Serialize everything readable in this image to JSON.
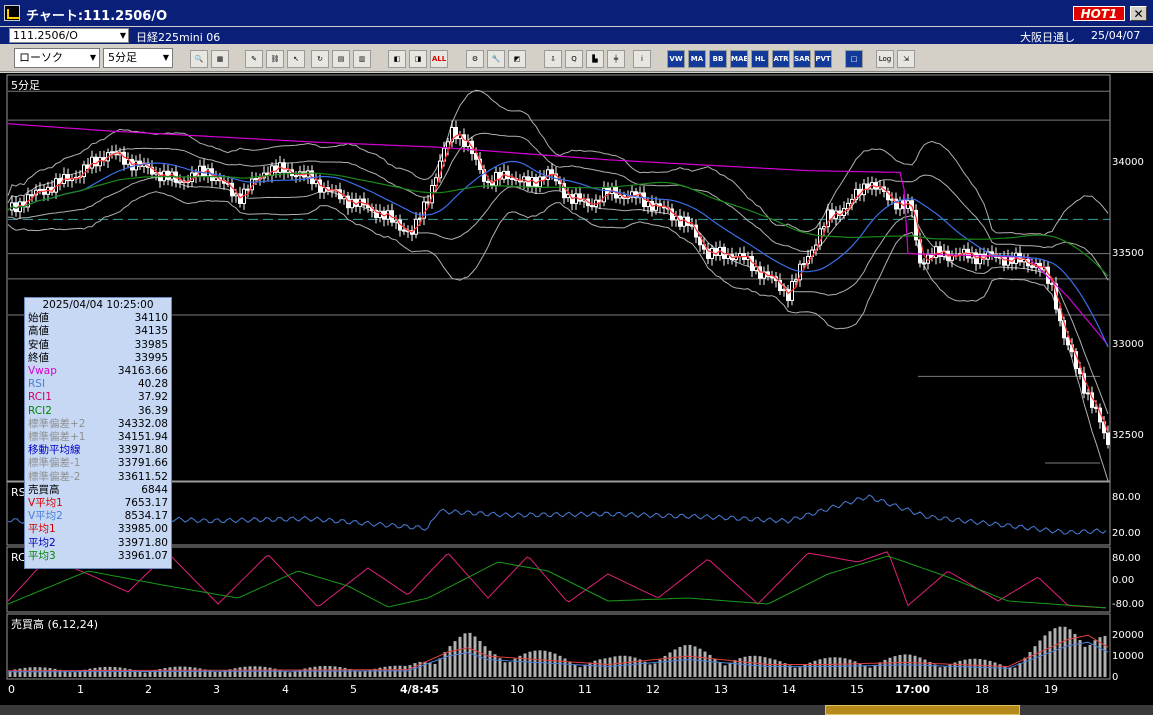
{
  "window": {
    "title": "チャート:111.2506/O",
    "hot_badge": "HOT1",
    "close_glyph": "✕"
  },
  "infobar": {
    "symbol_code": "111.2506/O",
    "symbol_name": "日経225mini 06",
    "market": "大阪日通し",
    "date": "25/04/07"
  },
  "toolbar": {
    "chart_type": "ローソク",
    "interval": "5分足",
    "buttons": [
      {
        "name": "zoom-icon",
        "label": "🔍"
      },
      {
        "name": "grid-icon",
        "label": "▦"
      },
      {
        "name": "pen-icon",
        "label": "✎"
      },
      {
        "name": "link-icon",
        "label": "⛓"
      },
      {
        "name": "cursor-icon",
        "label": "↖"
      },
      {
        "name": "refresh-icon",
        "label": "↻"
      },
      {
        "name": "doc-icon",
        "label": "▤"
      },
      {
        "name": "trash-icon",
        "label": "▥"
      },
      {
        "name": "candle-left-icon",
        "label": "◧"
      },
      {
        "name": "candle-right-icon",
        "label": "◨"
      },
      {
        "name": "all-icon",
        "label": "ALL"
      },
      {
        "name": "settings-icon",
        "label": "⚙"
      },
      {
        "name": "wrench-icon",
        "label": "🔧"
      },
      {
        "name": "color-icon",
        "label": "◩"
      },
      {
        "name": "arrow-down-icon",
        "label": "⇩"
      },
      {
        "name": "zoom-search-icon",
        "label": "Q"
      },
      {
        "name": "bar-chart-icon",
        "label": "▙"
      },
      {
        "name": "candle-add-icon",
        "label": "╪"
      },
      {
        "name": "info-icon",
        "label": "i"
      },
      {
        "name": "vwap-icon",
        "label": "VW"
      },
      {
        "name": "ma-icon",
        "label": "MA"
      },
      {
        "name": "bb-icon",
        "label": "BB"
      },
      {
        "name": "mae-icon",
        "label": "MAE"
      },
      {
        "name": "hl-icon",
        "label": "HL"
      },
      {
        "name": "atr-icon",
        "label": "ATR"
      },
      {
        "name": "sar-icon",
        "label": "SAR"
      },
      {
        "name": "pvt-icon",
        "label": "PVT"
      },
      {
        "name": "box-icon",
        "label": "□"
      },
      {
        "name": "log-icon",
        "label": "Log"
      },
      {
        "name": "export-icon",
        "label": "⇲"
      }
    ]
  },
  "panels": {
    "price_label": "5分足",
    "rsi_label": "RSI",
    "rci_label": "RCI",
    "volume_label": "売買高 (6,12,24)"
  },
  "axes": {
    "price_ticks": [
      "34000",
      "33500",
      "33000",
      "32500"
    ],
    "rsi_ticks": [
      "80.00",
      "20.00"
    ],
    "rci_ticks": [
      "80.00",
      "0.00",
      "-80.00"
    ],
    "volume_ticks": [
      "20000",
      "10000",
      "0"
    ],
    "x_ticks": [
      "0",
      "1",
      "2",
      "3",
      "4",
      "5",
      "4/8:45",
      "10",
      "11",
      "12",
      "13",
      "14",
      "15",
      "17:00",
      "18",
      "19"
    ]
  },
  "datapanel": {
    "datetime": "2025/04/04  10:25:00",
    "rows": [
      {
        "label": "始値",
        "value": "34110",
        "color": "#000000"
      },
      {
        "label": "高値",
        "value": "34135",
        "color": "#000000"
      },
      {
        "label": "安値",
        "value": "33985",
        "color": "#000000"
      },
      {
        "label": "終値",
        "value": "33995",
        "color": "#000000"
      },
      {
        "label": "Vwap",
        "value": "34163.66",
        "color": "#d400d4"
      },
      {
        "label": "RSI",
        "value": "40.28",
        "color": "#4a7ed8"
      },
      {
        "label": "RCI1",
        "value": "37.92",
        "color": "#d4006a"
      },
      {
        "label": "RCI2",
        "value": "36.39",
        "color": "#008800"
      },
      {
        "label": "標準偏差+2",
        "value": "34332.08",
        "color": "#909090"
      },
      {
        "label": "標準偏差+1",
        "value": "34151.94",
        "color": "#909090"
      },
      {
        "label": "移動平均線",
        "value": "33971.80",
        "color": "#0000c0"
      },
      {
        "label": "標準偏差-1",
        "value": "33791.66",
        "color": "#909090"
      },
      {
        "label": "標準偏差-2",
        "value": "33611.52",
        "color": "#909090"
      },
      {
        "label": "売買高",
        "value": "6844",
        "color": "#000000"
      },
      {
        "label": "V平均1",
        "value": "7653.17",
        "color": "#d40000"
      },
      {
        "label": "V平均2",
        "value": "8534.17",
        "color": "#4a7ed8"
      },
      {
        "label": "平均1",
        "value": "33985.00",
        "color": "#d40000"
      },
      {
        "label": "平均2",
        "value": "33971.80",
        "color": "#0000c0"
      },
      {
        "label": "平均3",
        "value": "33961.07",
        "color": "#008800"
      }
    ]
  },
  "colors": {
    "background": "#000000",
    "candle": "#ffffff",
    "vwap": "#d400d4",
    "ma_short": "#ff3030",
    "ma_mid": "#3a6ee8",
    "ma_long": "#1a8a1a",
    "bollinger": "#b0b0b0",
    "rsi": "#4a7ed8",
    "rci1": "#e0207a",
    "rci2": "#1a9a1a",
    "volume": "#b0b0b0",
    "dashed_level": "#3aa0a0"
  },
  "chart_data": {
    "type": "line",
    "title": "5分足",
    "price_range": [
      32300,
      34550
    ],
    "close_anchors": [
      [
        0,
        33800
      ],
      [
        30,
        33900
      ],
      [
        70,
        34000
      ],
      [
        100,
        34120
      ],
      [
        130,
        34050
      ],
      [
        170,
        33960
      ],
      [
        200,
        34020
      ],
      [
        230,
        33870
      ],
      [
        260,
        34030
      ],
      [
        290,
        34010
      ],
      [
        330,
        33880
      ],
      [
        370,
        33790
      ],
      [
        405,
        33670
      ],
      [
        425,
        33950
      ],
      [
        445,
        34260
      ],
      [
        460,
        34150
      ],
      [
        480,
        33950
      ],
      [
        500,
        34000
      ],
      [
        520,
        33940
      ],
      [
        540,
        34010
      ],
      [
        560,
        33880
      ],
      [
        580,
        33830
      ],
      [
        600,
        33900
      ],
      [
        630,
        33870
      ],
      [
        660,
        33790
      ],
      [
        680,
        33720
      ],
      [
        700,
        33560
      ],
      [
        730,
        33550
      ],
      [
        760,
        33430
      ],
      [
        780,
        33340
      ],
      [
        800,
        33550
      ],
      [
        820,
        33760
      ],
      [
        840,
        33830
      ],
      [
        860,
        33960
      ],
      [
        880,
        33870
      ],
      [
        905,
        33800
      ],
      [
        910,
        33520
      ],
      [
        930,
        33560
      ],
      [
        960,
        33550
      ],
      [
        990,
        33540
      ],
      [
        1030,
        33500
      ],
      [
        1045,
        33360
      ],
      [
        1055,
        33120
      ],
      [
        1070,
        32900
      ],
      [
        1085,
        32720
      ],
      [
        1100,
        32500
      ],
      [
        1108,
        32460
      ]
    ],
    "rsi_anchors": [
      [
        0,
        40
      ],
      [
        60,
        30
      ],
      [
        120,
        45
      ],
      [
        200,
        38
      ],
      [
        300,
        42
      ],
      [
        400,
        28
      ],
      [
        420,
        25
      ],
      [
        430,
        55
      ],
      [
        500,
        48
      ],
      [
        600,
        50
      ],
      [
        700,
        45
      ],
      [
        780,
        38
      ],
      [
        860,
        80
      ],
      [
        920,
        45
      ],
      [
        1000,
        30
      ],
      [
        1060,
        18
      ],
      [
        1108,
        22
      ]
    ],
    "rci1_anchors": [
      [
        0,
        -70
      ],
      [
        40,
        75
      ],
      [
        80,
        20
      ],
      [
        120,
        -40
      ],
      [
        160,
        90
      ],
      [
        210,
        -80
      ],
      [
        260,
        85
      ],
      [
        310,
        -90
      ],
      [
        360,
        40
      ],
      [
        400,
        -50
      ],
      [
        440,
        90
      ],
      [
        480,
        -60
      ],
      [
        520,
        80
      ],
      [
        560,
        -75
      ],
      [
        600,
        20
      ],
      [
        650,
        -60
      ],
      [
        700,
        70
      ],
      [
        750,
        -80
      ],
      [
        800,
        90
      ],
      [
        850,
        60
      ],
      [
        880,
        95
      ],
      [
        900,
        -85
      ],
      [
        940,
        30
      ],
      [
        990,
        -70
      ],
      [
        1030,
        10
      ],
      [
        1060,
        -85
      ],
      [
        1108,
        -95
      ]
    ],
    "rci2_anchors": [
      [
        0,
        -80
      ],
      [
        80,
        30
      ],
      [
        160,
        -20
      ],
      [
        230,
        -60
      ],
      [
        290,
        30
      ],
      [
        340,
        -20
      ],
      [
        380,
        -90
      ],
      [
        420,
        -60
      ],
      [
        490,
        60
      ],
      [
        540,
        30
      ],
      [
        600,
        -70
      ],
      [
        680,
        -60
      ],
      [
        760,
        -80
      ],
      [
        820,
        20
      ],
      [
        880,
        80
      ],
      [
        940,
        10
      ],
      [
        1000,
        -70
      ],
      [
        1108,
        -95
      ]
    ],
    "volume_profile": [
      [
        0,
        3000
      ],
      [
        400,
        3500
      ],
      [
        440,
        12000
      ],
      [
        460,
        14000
      ],
      [
        480,
        10000
      ],
      [
        600,
        6000
      ],
      [
        680,
        10000
      ],
      [
        760,
        6000
      ],
      [
        820,
        6000
      ],
      [
        900,
        7000
      ],
      [
        1000,
        5000
      ],
      [
        1060,
        18000
      ],
      [
        1080,
        20000
      ],
      [
        1108,
        12000
      ]
    ]
  }
}
